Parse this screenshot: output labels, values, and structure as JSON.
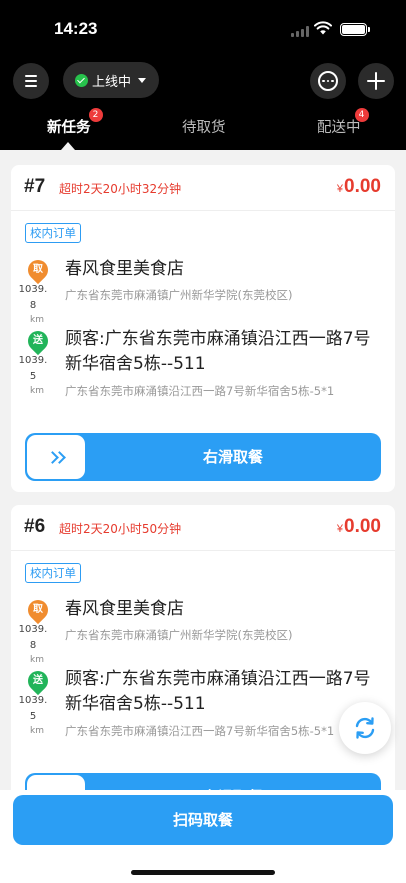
{
  "status_bar": {
    "time": "14:23"
  },
  "header": {
    "online_status": "上线中",
    "tabs": [
      {
        "label": "新任务",
        "badge": "2",
        "active": true
      },
      {
        "label": "待取货",
        "badge": "",
        "active": false
      },
      {
        "label": "配送中",
        "badge": "4",
        "active": false
      }
    ]
  },
  "orders": [
    {
      "number": "#7",
      "overdue": "超时2天20小时32分钟",
      "currency": "¥",
      "price": "0.00",
      "tag": "校内订单",
      "pickup": {
        "pin": "取",
        "distance_a": "1039.",
        "distance_b": "8",
        "unit": "km",
        "name": "春风食里美食店",
        "address": "广东省东莞市麻涌镇广州新华学院(东莞校区)"
      },
      "dropoff": {
        "pin": "送",
        "distance_a": "1039.",
        "distance_b": "5",
        "unit": "km",
        "name": "顾客:广东省东莞市麻涌镇沿江西一路7号新华宿舍5栋--511",
        "address": "广东省东莞市麻涌镇沿江西一路7号新华宿舍5栋-5*1"
      },
      "slide_label": "右滑取餐"
    },
    {
      "number": "#6",
      "overdue": "超时2天20小时50分钟",
      "currency": "¥",
      "price": "0.00",
      "tag": "校内订单",
      "pickup": {
        "pin": "取",
        "distance_a": "1039.",
        "distance_b": "8",
        "unit": "km",
        "name": "春风食里美食店",
        "address": "广东省东莞市麻涌镇广州新华学院(东莞校区)"
      },
      "dropoff": {
        "pin": "送",
        "distance_a": "1039.",
        "distance_b": "5",
        "unit": "km",
        "name": "顾客:广东省东莞市麻涌镇沿江西一路7号新华宿舍5栋--511",
        "address": "广东省东莞市麻涌镇沿江西一路7号新华宿舍5栋-5*1"
      },
      "slide_label": "右滑取餐"
    }
  ],
  "bottom": {
    "scan_label": "扫码取餐"
  },
  "colors": {
    "accent": "#2b9ef4",
    "alert": "#e63b2e",
    "pickup_pin": "#f08c2f",
    "dropoff_pin": "#22b45a"
  },
  "icons": [
    "menu-icon",
    "check-circle-icon",
    "chevron-down-icon",
    "chat-icon",
    "plus-icon",
    "double-chevron-right-icon",
    "refresh-icon"
  ]
}
